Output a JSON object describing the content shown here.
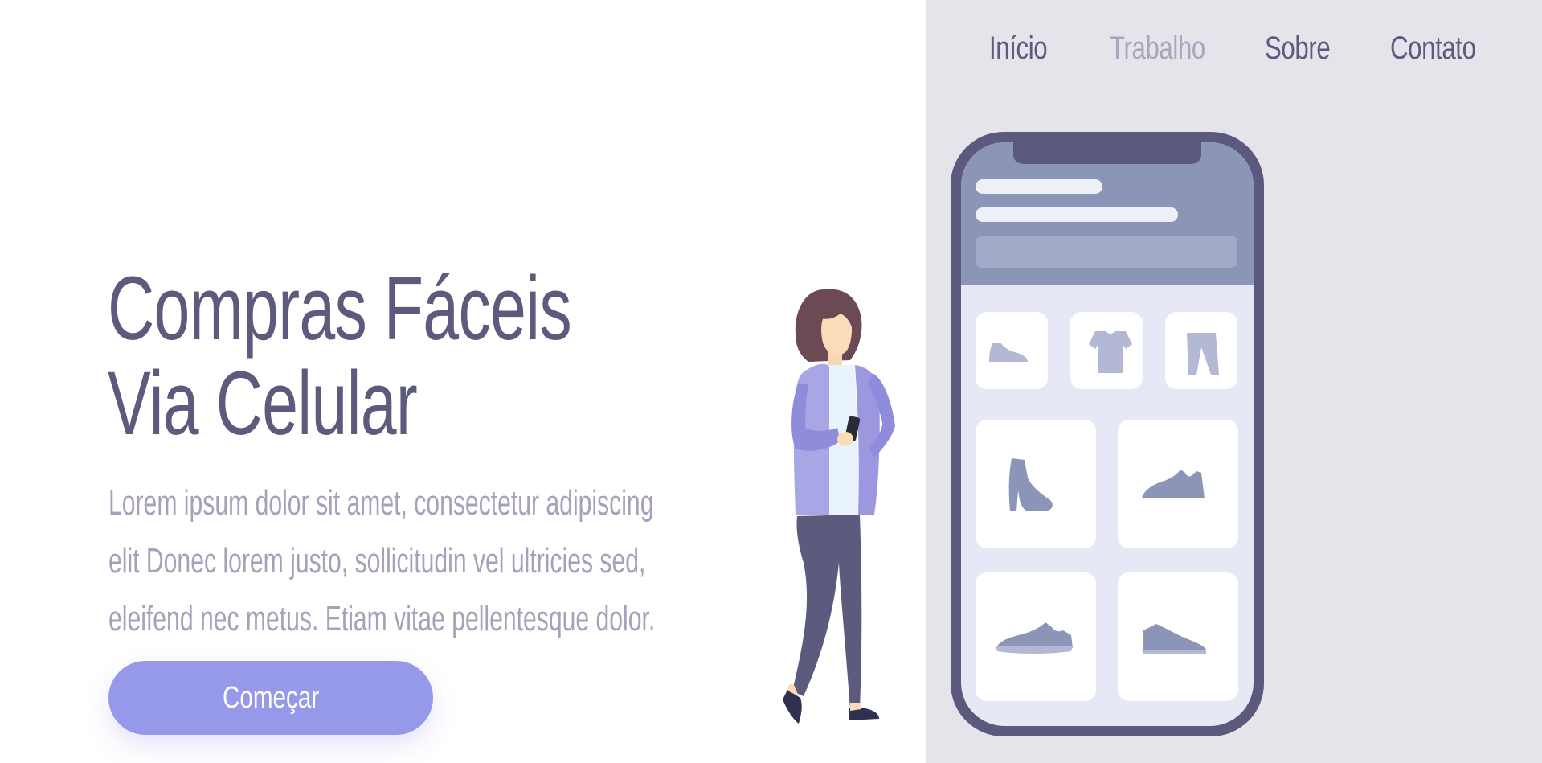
{
  "nav": {
    "items": [
      {
        "label": "Início",
        "active": false
      },
      {
        "label": "Trabalho",
        "active": true
      },
      {
        "label": "Sobre",
        "active": false
      },
      {
        "label": "Contato",
        "active": false
      }
    ]
  },
  "hero": {
    "title_line1": "Compras Fáceis",
    "title_line2": "Via Celular",
    "text_line1": "Lorem ipsum dolor sit amet, consectetur adipiscing",
    "text_line2": "elit Donec lorem justo, sollicitudin vel ultricies sed,",
    "text_line3": "eleifend nec metus. Etiam vitae pellentesque dolor.",
    "cta_label": "Começar"
  },
  "colors": {
    "primary_text": "#5d5b7d",
    "muted_text": "#a3a2ba",
    "accent": "#9699ea",
    "panel_bg": "#e5e4ea",
    "phone_frame": "#5b597e"
  },
  "illustration": {
    "icons": [
      "shoe-icon",
      "tshirt-icon",
      "pants-icon",
      "boot-icon",
      "sneaker-icon",
      "sneaker-icon",
      "sneaker-icon"
    ]
  }
}
